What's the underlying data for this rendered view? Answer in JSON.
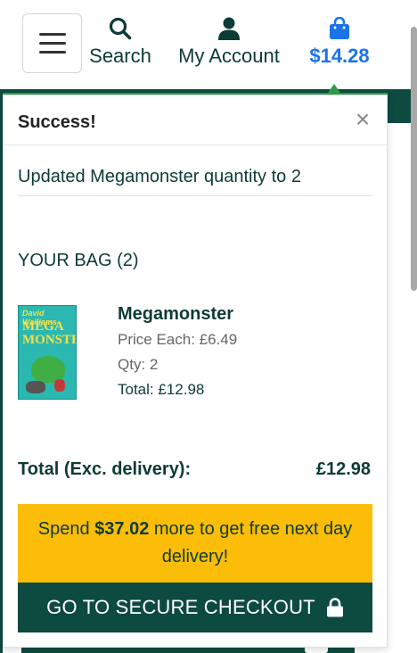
{
  "header": {
    "search_label": "Search",
    "account_label": "My Account",
    "bag_total": "$14.28"
  },
  "alert": {
    "title": "Success!",
    "close_glyph": "×",
    "message": "Updated Megamonster quantity to 2"
  },
  "bag": {
    "heading": "YOUR BAG (2)",
    "items": [
      {
        "name": "Megamonster",
        "cover_author": "David Walliams",
        "cover_title_1": "MEGA",
        "cover_title_2": "MONSTER",
        "price_each": "Price Each: £6.49",
        "qty": "Qty: 2",
        "total": "Total: £12.98"
      }
    ],
    "total_label": "Total (Exc. delivery):",
    "total_value": "£12.98"
  },
  "promo": {
    "prefix": "Spend ",
    "amount": "$37.02",
    "suffix": " more to get free next day delivery!"
  },
  "checkout": {
    "label": "GO TO SECURE CHECKOUT"
  },
  "icons": {
    "menu": "hamburger-menu-icon",
    "search": "search-icon",
    "account": "user-icon",
    "bag": "shopping-bag-icon",
    "close": "close-icon",
    "lock": "lock-icon"
  },
  "colors": {
    "brand_dark": "#0d4a40",
    "accent_green": "#2e9e4a",
    "bag_blue": "#1a73e8",
    "promo_yellow": "#fbbd08"
  }
}
